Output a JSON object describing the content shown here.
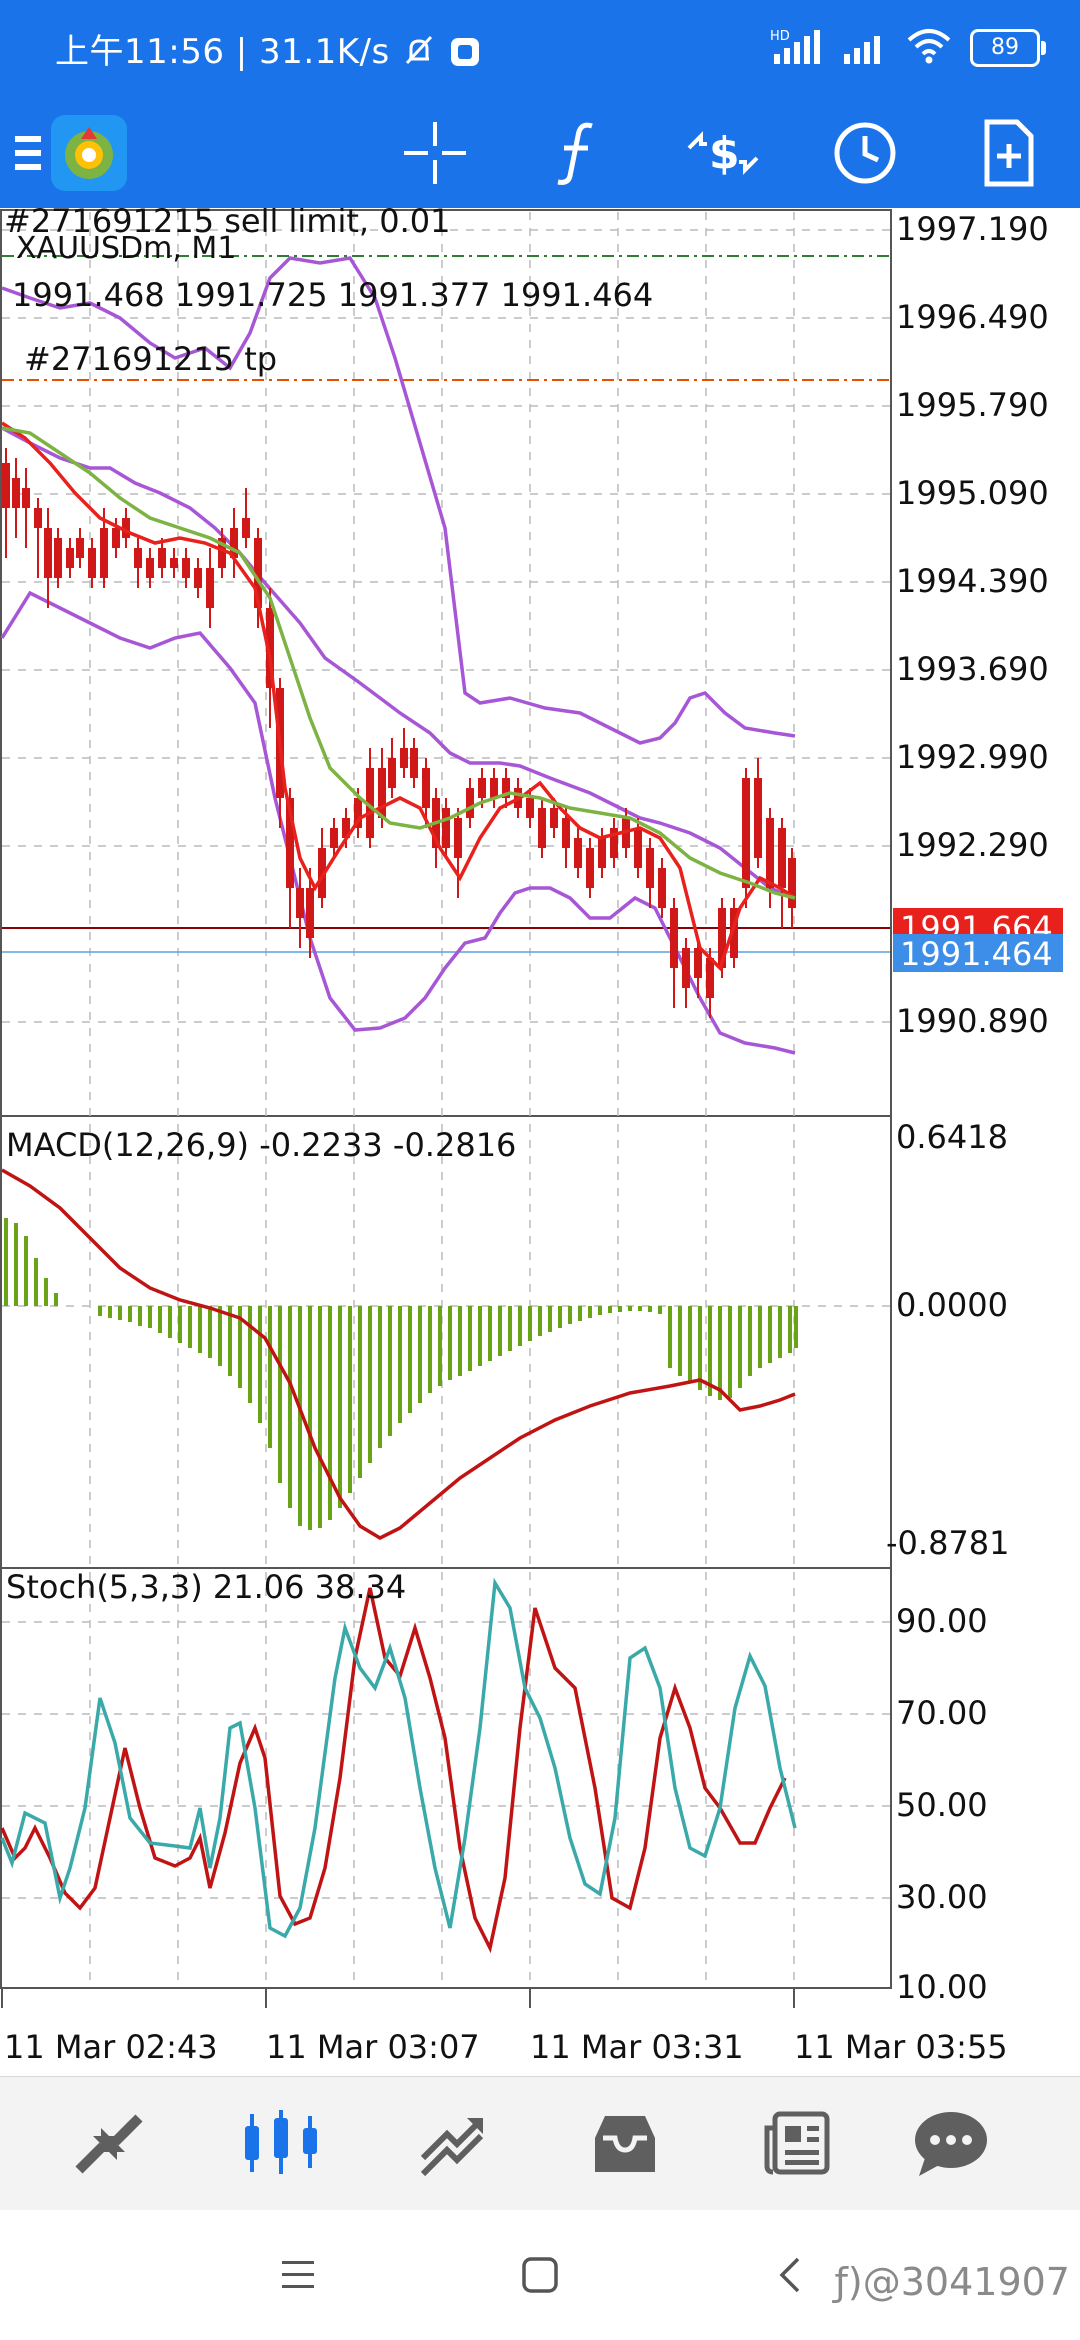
{
  "status_bar": {
    "time_speed": "上午11:56 | 31.1K/s",
    "network": "HD",
    "battery": "89",
    "icons": [
      "mute-bell-icon",
      "app-notification-icon",
      "signal-icon",
      "signal-icon",
      "wifi-icon",
      "battery-icon"
    ]
  },
  "toolbar": {
    "items": [
      "menu-icon",
      "metatrader-logo",
      "crosshair-icon",
      "indicators-icon",
      "trade-icon",
      "timeframe-icon",
      "new-order-icon"
    ]
  },
  "chart": {
    "order_label": "#271691215 sell limit, 0.01",
    "symbol_label": "XAUUSDm, M1",
    "ohlc": "1991.468 1991.725 1991.377 1991.464",
    "tp_label": "#271691215 tp",
    "price_ticks": [
      "1997.190",
      "1996.490",
      "1995.790",
      "1995.090",
      "1994.390",
      "1993.690",
      "1992.990",
      "1992.290",
      "1990.890"
    ],
    "ask_price": "1991.664",
    "bid_price": "1991.464",
    "ask_color": "#e8211d",
    "bid_color": "#3d8ee8",
    "macd_label": "MACD(12,26,9) -0.2233 -0.2816",
    "macd_ticks": [
      "0.6418",
      "0.0000",
      "-0.8781"
    ],
    "stoch_label": "Stoch(5,3,3) 21.06 38.34",
    "stoch_ticks": [
      "90.00",
      "70.00",
      "50.00",
      "30.00",
      "10.00"
    ],
    "time_ticks": [
      "11 Mar 02:43",
      "11 Mar 03:07",
      "11 Mar 03:31",
      "11 Mar 03:55"
    ]
  },
  "bottom_nav": {
    "items": [
      "quotes-icon",
      "chart-icon",
      "trade-history-icon",
      "inbox-icon",
      "news-icon",
      "chat-icon"
    ],
    "active": "chart-icon",
    "accent": "#1a73e8"
  },
  "system_nav": {
    "items": [
      "menu-lines-icon",
      "home-square-icon",
      "back-chevron-icon"
    ],
    "watermark": "ƒ)@3041907"
  }
}
